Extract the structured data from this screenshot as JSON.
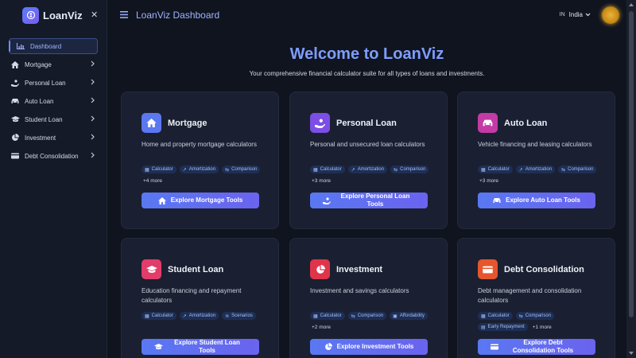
{
  "app": {
    "logo_text": "LoanViz",
    "header_title": "LoanViz Dashboard",
    "lang_code": "IN",
    "lang_label": "India"
  },
  "sidebar": {
    "items": [
      {
        "label": "Dashboard",
        "icon": "chart-bar-icon"
      },
      {
        "label": "Mortgage",
        "icon": "home-icon"
      },
      {
        "label": "Personal Loan",
        "icon": "hand-coin-icon"
      },
      {
        "label": "Auto Loan",
        "icon": "car-icon"
      },
      {
        "label": "Student Loan",
        "icon": "graduation-cap-icon"
      },
      {
        "label": "Investment",
        "icon": "pie-chart-icon"
      },
      {
        "label": "Debt Consolidation",
        "icon": "credit-card-icon"
      }
    ]
  },
  "main": {
    "welcome": "Welcome to LoanViz",
    "subtitle": "Your comprehensive financial calculator suite for all types of loans and investments.",
    "cards": [
      {
        "title": "Mortgage",
        "desc": "Home and property mortgage calculators",
        "tags": [
          "Calculator",
          "Amortization",
          "Comparison"
        ],
        "more": "+4 more",
        "button": "Explore Mortgage Tools",
        "color": "#5b78f2"
      },
      {
        "title": "Personal Loan",
        "desc": "Personal and unsecured loan calculators",
        "tags": [
          "Calculator",
          "Amortization",
          "Comparison"
        ],
        "more": "+3 more",
        "button": "Explore Personal Loan Tools",
        "color": "#7c4ee6"
      },
      {
        "title": "Auto Loan",
        "desc": "Vehicle financing and leasing calculators",
        "tags": [
          "Calculator",
          "Amortization",
          "Comparison"
        ],
        "more": "+3 more",
        "button": "Explore Auto Loan Tools",
        "color": "#c43aa6"
      },
      {
        "title": "Student Loan",
        "desc": "Education financing and repayment calculators",
        "tags": [
          "Calculator",
          "Amortization",
          "Scenarios"
        ],
        "more": "",
        "button": "Explore Student Loan Tools",
        "color": "#e23c6a"
      },
      {
        "title": "Investment",
        "desc": "Investment and savings calculators",
        "tags": [
          "Calculator",
          "Comparison",
          "Affordability"
        ],
        "more": "+2 more",
        "button": "Explore Investment Tools",
        "color": "#e0344a"
      },
      {
        "title": "Debt Consolidation",
        "desc": "Debt management and consolidation calculators",
        "tags": [
          "Calculator",
          "Comparison",
          "Early Repayment"
        ],
        "more": "+1 more",
        "button": "Explore Debt Consolidation Tools",
        "color": "#e5562e"
      }
    ]
  },
  "colors": {
    "accent": "#7e9dff",
    "background": "#10141f",
    "card": "#1a2031"
  }
}
